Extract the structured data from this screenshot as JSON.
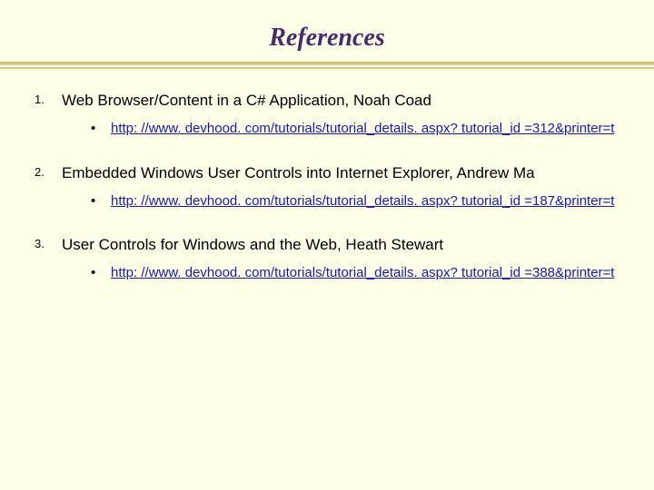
{
  "title": "References",
  "references": [
    {
      "text": "Web Browser/Content in a C# Application, Noah Coad",
      "link": "http: //www. devhood. com/tutorials/tutorial_details. aspx? tutorial_id =312&printer=t"
    },
    {
      "text": "Embedded Windows User Controls into Internet Explorer, Andrew Ma",
      "link": "http: //www. devhood. com/tutorials/tutorial_details. aspx? tutorial_id =187&printer=t"
    },
    {
      "text": "User Controls for Windows and the Web, Heath Stewart",
      "link": "http: //www. devhood. com/tutorials/tutorial_details. aspx? tutorial_id =388&printer=t"
    }
  ]
}
